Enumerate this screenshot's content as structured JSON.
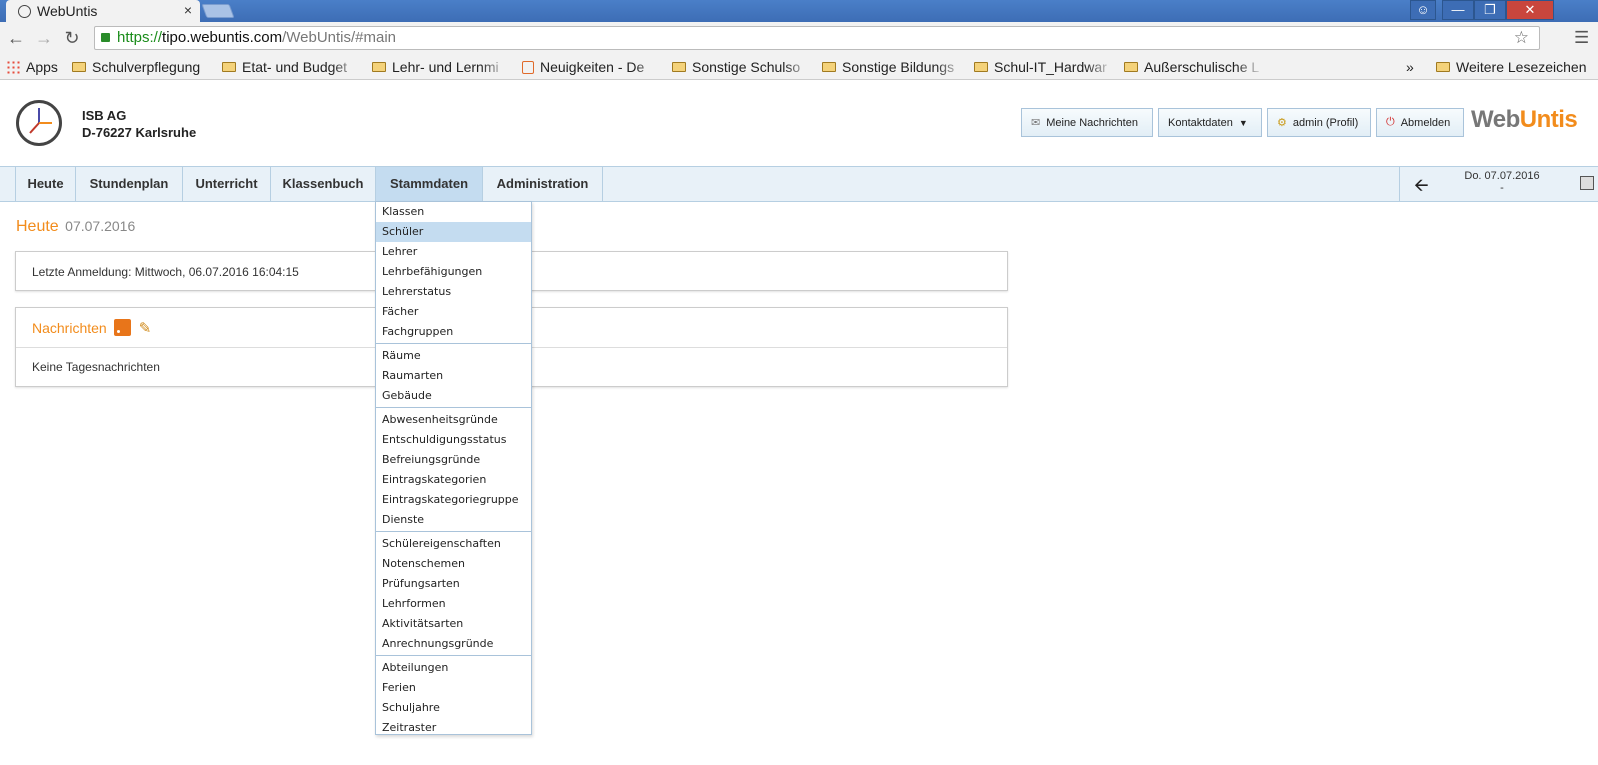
{
  "browser": {
    "tab_title": "WebUntis",
    "tab_close": "×",
    "url_https": "https://",
    "url_host": "tipo.webuntis.com",
    "url_path": "/WebUntis/#main",
    "bookmarks": [
      "Apps",
      "Schulverpflegung",
      "Etat- und Budget",
      "Lehr- und Lernmi",
      "Neuigkeiten - De",
      "Sonstige Schulso",
      "Sonstige Bildungs",
      "Schul-IT_Hardwar",
      "Außerschulische L"
    ],
    "more_bookmarks": "»",
    "other_bookmarks": "Weitere Lesezeichen"
  },
  "header": {
    "org_name": "ISB AG",
    "org_location": "D-76227 Karlsruhe",
    "buttons": {
      "messages": "Meine Nachrichten",
      "contact": "Kontaktdaten",
      "profile": "admin (Profil)",
      "logout": "Abmelden"
    },
    "brand_web": "Web",
    "brand_untis": "Untis"
  },
  "nav": {
    "items": [
      "Heute",
      "Stundenplan",
      "Unterricht",
      "Klassenbuch",
      "Stammdaten",
      "Administration"
    ],
    "active": "Stammdaten",
    "date": "Do. 07.07.2016",
    "date_sub": "-"
  },
  "content": {
    "heading": "Heute",
    "heading_date": "07.07.2016",
    "last_login": "Letzte Anmeldung: Mittwoch, 06.07.2016 16:04:15",
    "news_title": "Nachrichten",
    "news_empty": "Keine Tagesnachrichten"
  },
  "dropdown": {
    "groups": [
      [
        "Klassen",
        "Schüler",
        "Lehrer",
        "Lehrbefähigungen",
        "Lehrerstatus",
        "Fächer",
        "Fachgruppen"
      ],
      [
        "Räume",
        "Raumarten",
        "Gebäude"
      ],
      [
        "Abwesenheitsgründe",
        "Entschuldigungsstatus",
        "Befreiungsgründe",
        "Eintragskategorien",
        "Eintragskategoriegruppe",
        "Dienste"
      ],
      [
        "Schülereigenschaften",
        "Notenschemen",
        "Prüfungsarten",
        "Lehrformen",
        "Aktivitätsarten",
        "Anrechnungsgründe"
      ],
      [
        "Abteilungen",
        "Ferien",
        "Schuljahre",
        "Zeitraster"
      ]
    ],
    "highlighted": "Schüler"
  },
  "colors": {
    "accent_orange": "#f28c1c",
    "nav_bg": "#e8f1f8",
    "nav_active": "#c4dcf0",
    "border_blue": "#a9c3da"
  }
}
